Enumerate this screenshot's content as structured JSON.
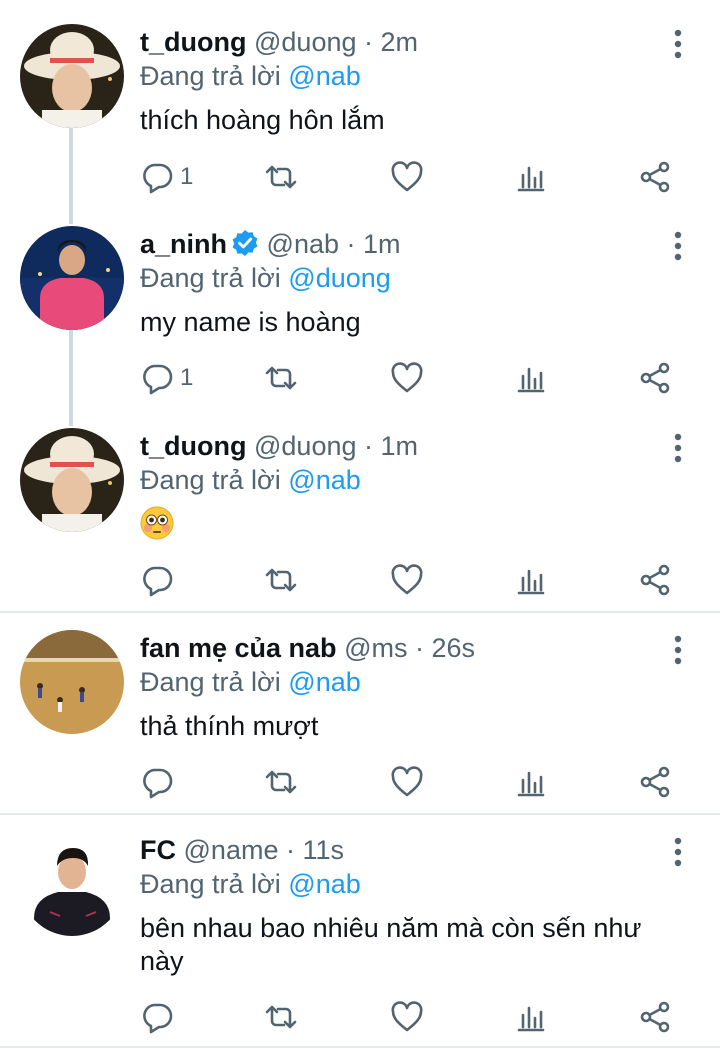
{
  "tweets": [
    {
      "name": "t_duong",
      "handle": "@duong",
      "time": "2m",
      "reply_prefix": "Đang trả lời",
      "reply_to": "@nab",
      "text": "thích hoàng hôn lắm",
      "reply_count": "1",
      "verified": false
    },
    {
      "name": "a_ninh",
      "handle": "@nab",
      "time": "1m",
      "reply_prefix": "Đang trả lời",
      "reply_to": "@duong",
      "text": "my name is hoàng",
      "reply_count": "1",
      "verified": true
    },
    {
      "name": "t_duong",
      "handle": "@duong",
      "time": "1m",
      "reply_prefix": "Đang trả lời",
      "reply_to": "@nab",
      "text": "",
      "emoji": "flushed-face",
      "reply_count": "",
      "verified": false
    },
    {
      "name": "fan mẹ của nab",
      "handle": "@ms",
      "time": "26s",
      "reply_prefix": "Đang trả lời",
      "reply_to": "@nab",
      "text": "thả thính mượt",
      "reply_count": "",
      "verified": false
    },
    {
      "name": "FC",
      "handle": "@name",
      "time": "11s",
      "reply_prefix": "Đang trả lời",
      "reply_to": "@nab",
      "text": "bên nhau bao nhiêu năm mà còn sến như này",
      "reply_count": "",
      "verified": false
    }
  ],
  "separator": "·",
  "colors": {
    "accent": "#1d9bf0",
    "muted": "#536471",
    "thread_line": "#cfd9de"
  },
  "icons": [
    "more-vertical-icon",
    "reply-icon",
    "retweet-icon",
    "like-icon",
    "analytics-icon",
    "share-icon",
    "verified-icon"
  ]
}
